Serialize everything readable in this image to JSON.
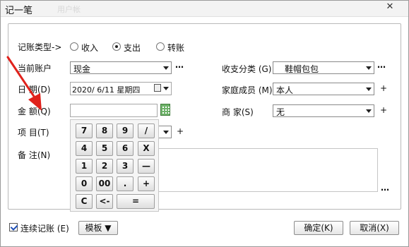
{
  "window": {
    "title": "记一笔",
    "ghost_text": "用户帐",
    "close_label": "✕"
  },
  "type_row": {
    "label": "记账类型->",
    "options": [
      {
        "label": "收入",
        "selected": false
      },
      {
        "label": "支出",
        "selected": true
      },
      {
        "label": "转账",
        "selected": false
      }
    ]
  },
  "account": {
    "label": "当前账户",
    "value": "现金"
  },
  "category": {
    "label": "收支分类 (G)",
    "value": "鞋帽包包"
  },
  "date": {
    "label": "日    期(D)",
    "value": "2020/ 6/11 星期四"
  },
  "member": {
    "label": "家庭成员 (M)",
    "value": "本人"
  },
  "amount": {
    "label": "金    额(Q)",
    "value": ""
  },
  "merchant": {
    "label": "商    家(S)",
    "value": "无"
  },
  "project": {
    "label": "项    目(T)"
  },
  "memo": {
    "label": "备    注(N)",
    "value": ""
  },
  "keypad": {
    "keys": [
      [
        "7",
        "8",
        "9",
        "/"
      ],
      [
        "4",
        "5",
        "6",
        "X"
      ],
      [
        "1",
        "2",
        "3",
        "—"
      ],
      [
        "0",
        "00",
        ".",
        "+"
      ],
      [
        "C",
        "<-",
        "="
      ]
    ]
  },
  "footer": {
    "continuous_label": "连续记账 (E)",
    "continuous_checked": true,
    "template_label": "模板 ▼",
    "ok_label": "确定(K)",
    "cancel_label": "取消(X)"
  },
  "misc": {
    "dots": "…",
    "plus": "+"
  },
  "colors": {
    "arrow": "#e0221c",
    "check": "#1e4fb6",
    "calculator": "#4e9a48"
  }
}
